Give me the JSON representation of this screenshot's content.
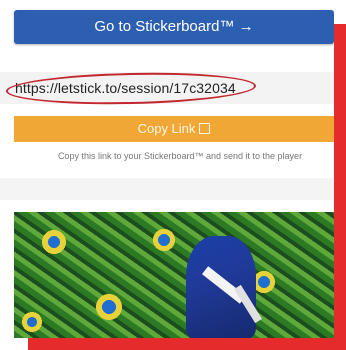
{
  "goto_button": {
    "label": "Go to Stickerboard™ →"
  },
  "session_link": {
    "url": "https://letstick.to/session/17c32034"
  },
  "copy_button": {
    "label": "Copy Link"
  },
  "hint": {
    "text": "Copy this link to your Stickerboard™ and send it to the player"
  },
  "colors": {
    "goto_button": "#2c5fb0",
    "copy_button": "#f1a735",
    "annotation": "#e52b2b"
  },
  "icons": {
    "copy": "copy-icon"
  }
}
